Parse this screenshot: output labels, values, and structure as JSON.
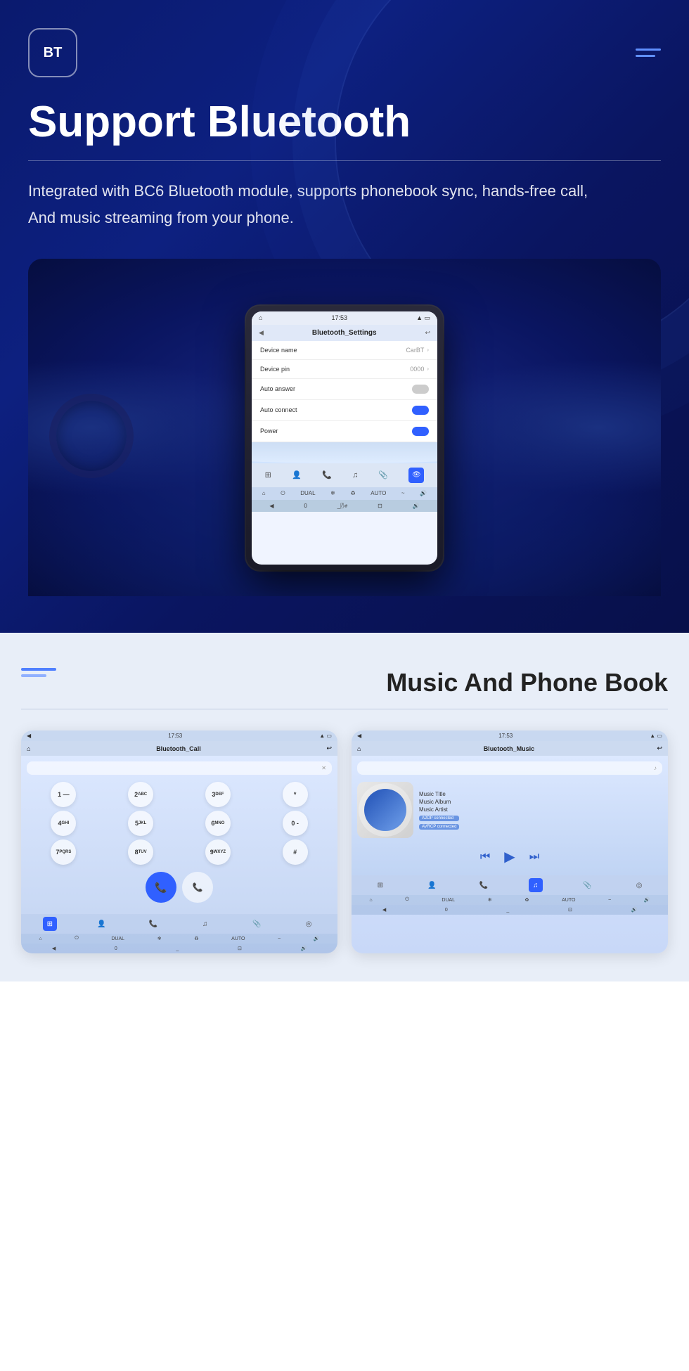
{
  "hero": {
    "logo_text": "BT",
    "title": "Support Bluetooth",
    "description_line1": "Integrated with BC6 Bluetooth module, supports phonebook sync, hands-free call,",
    "description_line2": "And music streaming from your phone.",
    "screen": {
      "time": "17:53",
      "title": "Bluetooth_Settings",
      "rows": [
        {
          "label": "Device name",
          "value": "CarBT",
          "type": "chevron"
        },
        {
          "label": "Device pin",
          "value": "0000",
          "type": "chevron"
        },
        {
          "label": "Auto answer",
          "value": "",
          "type": "toggle-off"
        },
        {
          "label": "Auto connect",
          "value": "",
          "type": "toggle-on"
        },
        {
          "label": "Power",
          "value": "",
          "type": "toggle-on"
        }
      ]
    }
  },
  "bottom": {
    "title": "Music And Phone Book",
    "left_screen": {
      "time": "17:53",
      "title": "Bluetooth_Call",
      "dialpad": [
        [
          "1 —",
          "2 ABC",
          "3 DEF",
          "*"
        ],
        [
          "4 GHI",
          "5 JKL",
          "6 MNO",
          "0 -"
        ],
        [
          "7 PQRS",
          "8 TUV",
          "9 WXYZ",
          "#"
        ]
      ]
    },
    "right_screen": {
      "time": "17:53",
      "title": "Bluetooth_Music",
      "music_title": "Music Title",
      "music_album": "Music Album",
      "music_artist": "Music Artist",
      "badge1": "A2DP connected",
      "badge2": "AVRCP connected"
    }
  }
}
